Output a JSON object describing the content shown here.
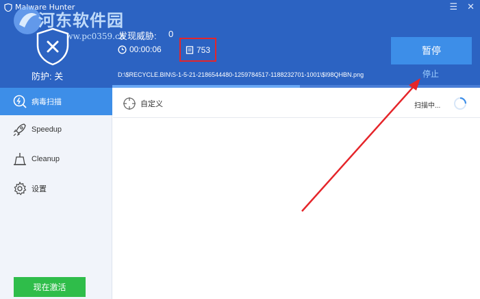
{
  "app": {
    "title": "Malware Hunter"
  },
  "watermark": {
    "text": "河东软件园",
    "url": "www.pc0359.cn"
  },
  "window_controls": {
    "menu_glyph": "☰",
    "close_glyph": "✕"
  },
  "status": {
    "protection_label": "防护: 关",
    "threats_label": "发现威胁:",
    "threats_count": "0",
    "elapsed_time": "00:00:06",
    "files_scanned": "753",
    "current_path": "D:\\$RECYCLE.BIN\\S-1-5-21-2186544480-1259784517-1188232701-1001\\$I98QHBN.png",
    "progress_percent": 51
  },
  "actions": {
    "pause_label": "暂停",
    "stop_label": "停止"
  },
  "sidebar": {
    "items": [
      {
        "label": "病毒扫描",
        "icon": "scan-icon",
        "active": true
      },
      {
        "label": "Speedup",
        "icon": "rocket-icon",
        "active": false
      },
      {
        "label": "Cleanup",
        "icon": "broom-icon",
        "active": false
      },
      {
        "label": "设置",
        "icon": "gear-icon",
        "active": false
      }
    ],
    "activate_label": "现在激活"
  },
  "main": {
    "custom_label": "自定义",
    "scanning_label": "扫描中..."
  },
  "colors": {
    "header": "#2c63c2",
    "accent": "#3d8ee8",
    "activate": "#2fbd4a",
    "annotation": "#e5252a"
  }
}
